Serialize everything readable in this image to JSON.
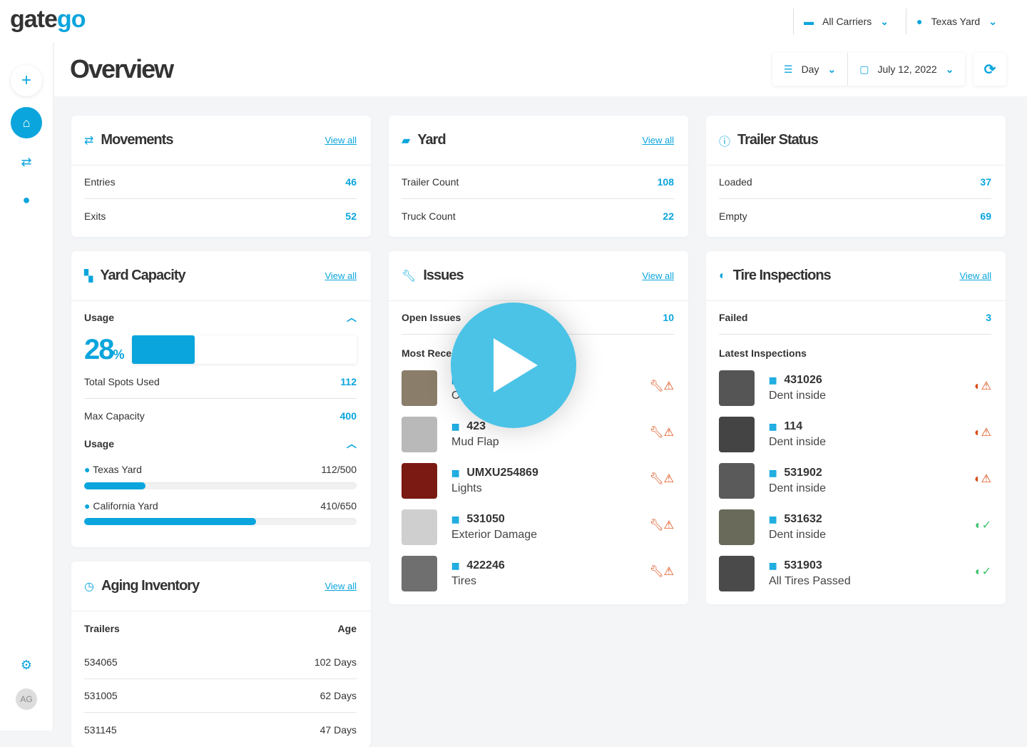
{
  "app": {
    "logo": "gatego",
    "carriers": "All Carriers",
    "yard": "Texas Yard",
    "user_initials": "AG"
  },
  "page": {
    "title": "Overview",
    "period": "Day",
    "date": "July 12, 2022"
  },
  "movements": {
    "title": "Movements",
    "view_all": "View all",
    "rows": [
      {
        "label": "Entries",
        "value": "46"
      },
      {
        "label": "Exits",
        "value": "52"
      }
    ]
  },
  "yard": {
    "title": "Yard",
    "view_all": "View all",
    "rows": [
      {
        "label": "Trailer Count",
        "value": "108"
      },
      {
        "label": "Truck Count",
        "value": "22"
      }
    ]
  },
  "trailer_status": {
    "title": "Trailer Status",
    "rows": [
      {
        "label": "Loaded",
        "value": "37"
      },
      {
        "label": "Empty",
        "value": "69"
      }
    ]
  },
  "capacity": {
    "title": "Yard Capacity",
    "view_all": "View all",
    "usage_label": "Usage",
    "percent": "28",
    "percent_sign": "%",
    "percent_value": 28,
    "total_label": "Total Spots Used",
    "total": "112",
    "max_label": "Max Capacity",
    "max": "400",
    "usage2_label": "Usage",
    "yards": [
      {
        "name": "Texas Yard",
        "value": "112/500",
        "fraction": 0.224
      },
      {
        "name": "California Yard",
        "value": "410/650",
        "fraction": 0.631
      }
    ]
  },
  "aging": {
    "title": "Aging Inventory",
    "view_all": "View all",
    "col1": "Trailers",
    "col2": "Age",
    "rows": [
      {
        "id": "534065",
        "age": "102 Days"
      },
      {
        "id": "531005",
        "age": "62 Days"
      },
      {
        "id": "531145",
        "age": "47 Days"
      }
    ]
  },
  "issues": {
    "title": "Issues",
    "view_all": "View all",
    "open_label": "Open Issues",
    "open": "10",
    "recent_label": "Most Rece",
    "items": [
      {
        "id": "53",
        "desc": "Other"
      },
      {
        "id": "423",
        "desc": "Mud Flap"
      },
      {
        "id": "UMXU254869",
        "desc": "Lights"
      },
      {
        "id": "531050",
        "desc": "Exterior Damage"
      },
      {
        "id": "422246",
        "desc": "Tires"
      }
    ]
  },
  "tires": {
    "title": "Tire Inspections",
    "view_all": "View all",
    "failed_label": "Failed",
    "failed": "3",
    "latest_label": "Latest Inspections",
    "items": [
      {
        "id": "431026",
        "desc": "Dent inside",
        "status": "fail"
      },
      {
        "id": "114",
        "desc": "Dent inside",
        "status": "fail"
      },
      {
        "id": "531902",
        "desc": "Dent inside",
        "status": "fail"
      },
      {
        "id": "531632",
        "desc": "Dent inside",
        "status": "pass"
      },
      {
        "id": "531903",
        "desc": "All Tires Passed",
        "status": "pass"
      }
    ]
  },
  "colors": {
    "accent": "#0aa5dd",
    "warning": "#d9480f",
    "pass": "#3cc26a"
  }
}
